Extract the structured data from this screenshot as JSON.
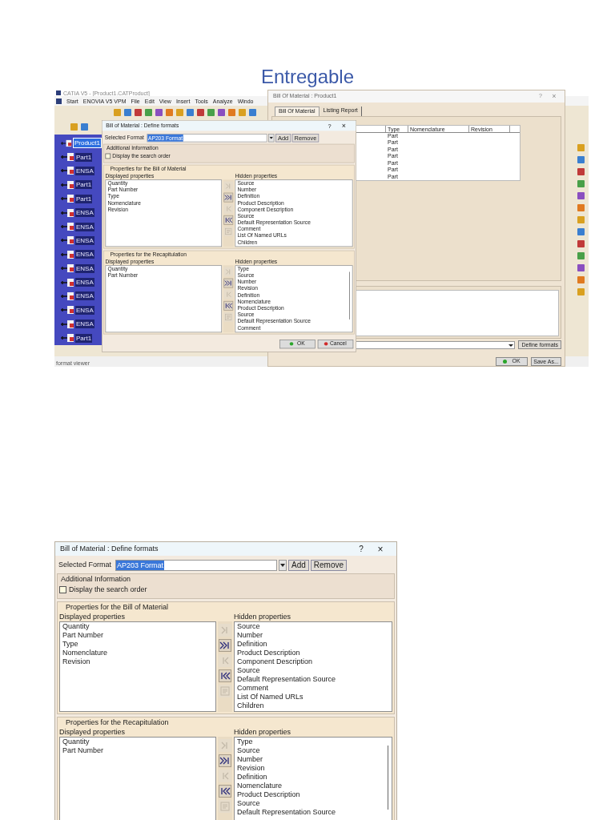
{
  "heading": "Entregable",
  "screenshot_1": {
    "catia": {
      "title": "CATIA V5 - [Product1.CATProduct]",
      "menu": [
        "Start",
        "ENOVIA V5 VPM",
        "File",
        "Edit",
        "View",
        "Insert",
        "Tools",
        "Analyze",
        "Windo"
      ],
      "tree": [
        {
          "label": "Product1",
          "selected": true
        },
        {
          "label": "Part1",
          "selected": false
        },
        {
          "label": "ENSA",
          "selected": false
        },
        {
          "label": "Part1",
          "selected": false
        },
        {
          "label": "Part1",
          "selected": false
        },
        {
          "label": "ENSA",
          "selected": false
        },
        {
          "label": "ENSA",
          "selected": false
        },
        {
          "label": "ENSA",
          "selected": false
        },
        {
          "label": "ENSA",
          "selected": false
        },
        {
          "label": "ENSA",
          "selected": false
        },
        {
          "label": "ENSA",
          "selected": false
        },
        {
          "label": "ENSA",
          "selected": false
        },
        {
          "label": "ENSA",
          "selected": false
        },
        {
          "label": "ENSA",
          "selected": false
        },
        {
          "label": "Part1",
          "selected": false
        }
      ],
      "status": "format viewer"
    },
    "bom_dialog": {
      "title": "Bill Of Material : Product1",
      "help": "?",
      "close": "×",
      "tabs": [
        {
          "label": "Bill Of Material",
          "selected": true
        },
        {
          "label": "Listing Report",
          "selected": false
        }
      ],
      "columns": [
        "Type",
        "Nomenclature",
        "Revision"
      ],
      "rows": [
        {
          "type": "Part"
        },
        {
          "type": "Part"
        },
        {
          "type": "Part"
        },
        {
          "type": "Part"
        },
        {
          "type": "Part"
        },
        {
          "type": "Part"
        },
        {
          "type": "Part"
        }
      ],
      "define_formats": "Define formats",
      "ok": "OK",
      "save_as": "Save As..."
    },
    "define_dialog": {
      "title": "Bill of Material : Define formats",
      "help": "?",
      "close": "×",
      "format_label": "Selected Format",
      "format_value": "AP203 Format",
      "add": "Add",
      "remove": "Remove",
      "additional": {
        "title": "Additional Information",
        "checkbox": "Display the search order",
        "checked": false
      },
      "groups": [
        {
          "title": "Properties for the Bill of Material",
          "displayed_label": "Displayed properties",
          "hidden_label": "Hidden properties",
          "displayed": [
            "Quantity",
            "Part Number",
            "Type",
            "Nomenclature",
            "Revision"
          ],
          "hidden": [
            "Source",
            "Number",
            "Definition",
            "Product Description",
            "Component Description",
            "Source",
            "Default Representation Source",
            "Comment",
            "List Of Named URLs",
            "Children"
          ],
          "scrollbar": false,
          "move_buttons": [
            {
              "kind": "right",
              "disabled": true
            },
            {
              "kind": "all-right",
              "disabled": false
            },
            {
              "kind": "left",
              "disabled": true
            },
            {
              "kind": "all-left",
              "disabled": false
            },
            {
              "kind": "edit",
              "disabled": true
            }
          ]
        },
        {
          "title": "Properties for the Recapitulation",
          "displayed_label": "Displayed properties",
          "hidden_label": "Hidden properties",
          "displayed": [
            "Quantity",
            "Part Number"
          ],
          "hidden": [
            "Type",
            "Source",
            "Number",
            "Revision",
            "Definition",
            "Nomenclature",
            "Product Description",
            "Source",
            "Default Representation Source",
            "Comment"
          ],
          "scrollbar": true,
          "move_buttons": [
            {
              "kind": "right",
              "disabled": true
            },
            {
              "kind": "all-right",
              "disabled": false
            },
            {
              "kind": "left",
              "disabled": true
            },
            {
              "kind": "all-left",
              "disabled": false
            },
            {
              "kind": "edit",
              "disabled": true
            }
          ]
        }
      ],
      "ok": "OK",
      "cancel": "Cancel"
    }
  },
  "screenshot_2": {
    "define_dialog": {
      "title": "Bill of Material : Define formats",
      "help": "?",
      "close": "×",
      "format_label": "Selected Format",
      "format_value": "AP203 Format",
      "add": "Add",
      "remove": "Remove",
      "additional": {
        "title": "Additional Information",
        "checkbox": "Display the search order",
        "checked": false
      },
      "groups": [
        {
          "title": "Properties for the Bill of Material",
          "displayed_label": "Displayed properties",
          "hidden_label": "Hidden properties",
          "displayed": [
            "Quantity",
            "Part Number",
            "Type",
            "Nomenclature",
            "Revision"
          ],
          "hidden": [
            "Source",
            "Number",
            "Definition",
            "Product Description",
            "Component Description",
            "Source",
            "Default Representation Source",
            "Comment",
            "List Of Named URLs",
            "Children"
          ],
          "scrollbar": false,
          "move_buttons": [
            {
              "kind": "right",
              "disabled": true
            },
            {
              "kind": "all-right",
              "disabled": false
            },
            {
              "kind": "left",
              "disabled": true
            },
            {
              "kind": "all-left",
              "disabled": false
            },
            {
              "kind": "edit",
              "disabled": true
            }
          ]
        },
        {
          "title": "Properties for the Recapitulation",
          "displayed_label": "Displayed properties",
          "hidden_label": "Hidden properties",
          "displayed": [
            "Quantity",
            "Part Number"
          ],
          "hidden": [
            "Type",
            "Source",
            "Number",
            "Revision",
            "Definition",
            "Nomenclature",
            "Product Description",
            "Source",
            "Default Representation Source"
          ],
          "scrollbar": true,
          "move_buttons": [
            {
              "kind": "right",
              "disabled": true
            },
            {
              "kind": "all-right",
              "disabled": false
            },
            {
              "kind": "left",
              "disabled": true
            },
            {
              "kind": "all-left",
              "disabled": false
            },
            {
              "kind": "edit",
              "disabled": true
            }
          ]
        }
      ]
    }
  }
}
